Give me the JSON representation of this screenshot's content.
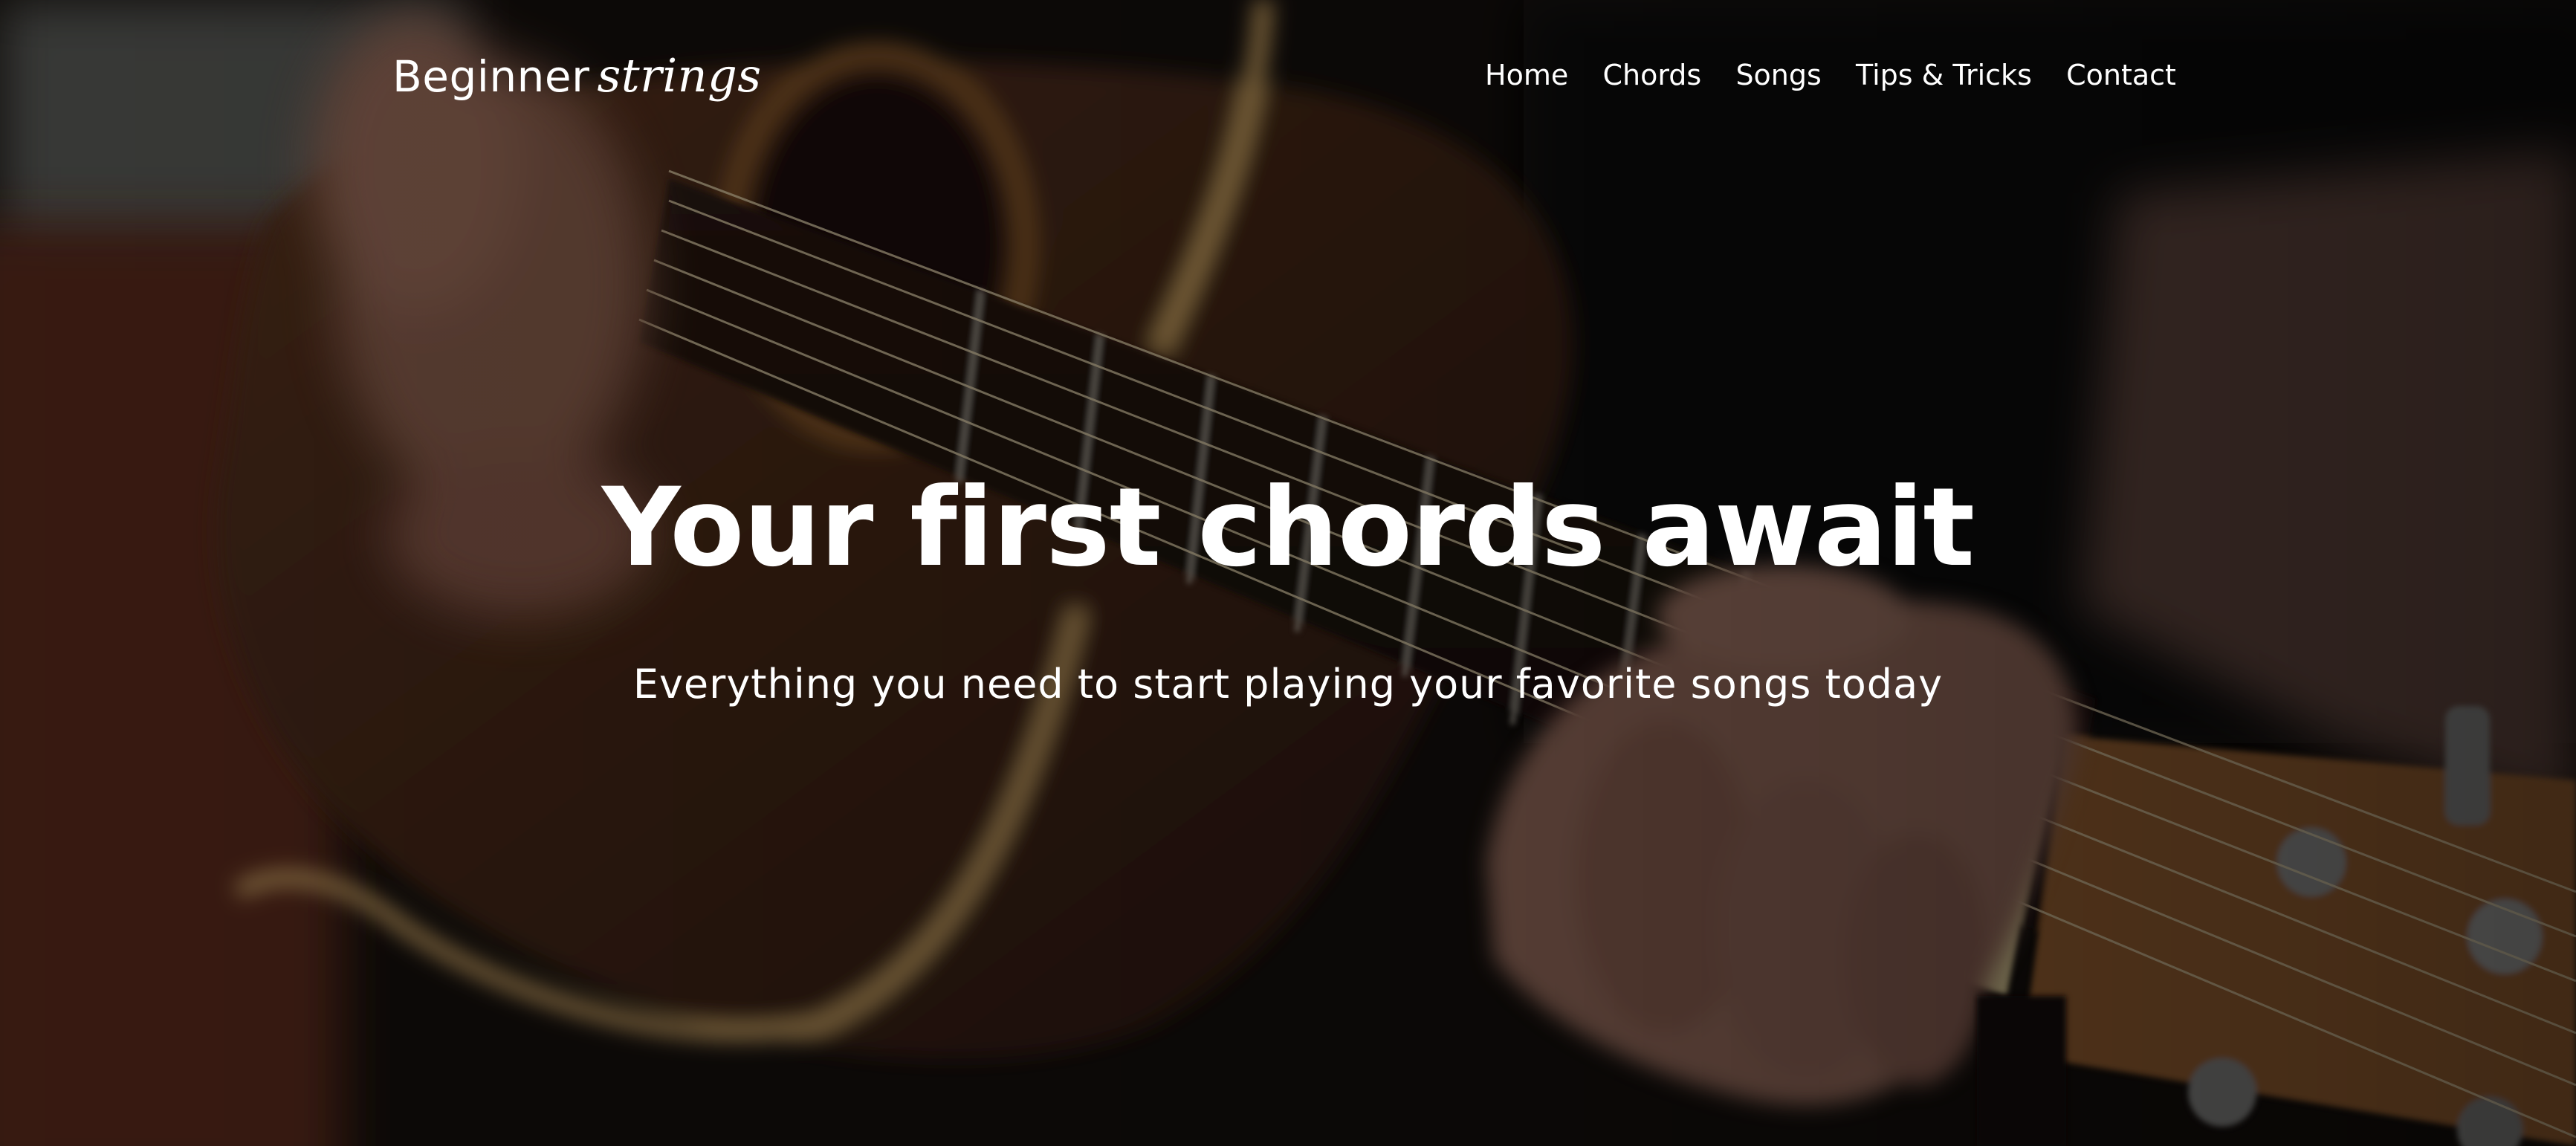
{
  "site": {
    "brand_regular": "Beginner",
    "brand_script": "strings"
  },
  "nav": {
    "items": [
      {
        "label": "Home"
      },
      {
        "label": "Chords"
      },
      {
        "label": "Songs"
      },
      {
        "label": "Tips & Tricks"
      },
      {
        "label": "Contact"
      }
    ]
  },
  "hero": {
    "title": "Your first chords await",
    "subtitle": "Everything you need to start playing your favorite songs today",
    "background_image": "guitar-playing-photo"
  },
  "colors": {
    "text": "#ffffff",
    "overlay": "#000000"
  }
}
